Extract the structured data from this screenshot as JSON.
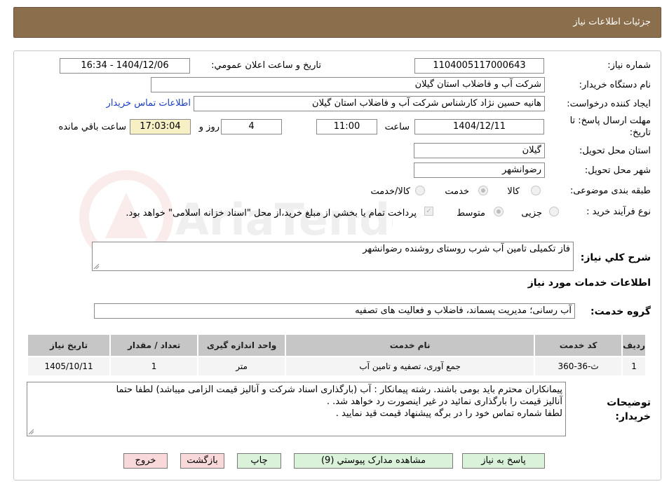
{
  "header": {
    "title": "جزئیات اطلاعات نیاز"
  },
  "form": {
    "need_number_label": "شماره نیاز:",
    "need_number": "1104005117000643",
    "announce_label": "تاریخ و ساعت اعلان عمومي:",
    "announce_value": "1404/12/06 - 16:34",
    "buyer_org_label": "نام دستگاه خريدار:",
    "buyer_org": "شرکت آب و فاضلاب استان گیلان",
    "requester_label": "ايجاد کننده درخواست:",
    "requester": "هانیه حسین نژاد کارشناس شرکت آب و فاضلاب استان گیلان",
    "contact_link": "اطلاعات تماس خريدار",
    "deadline_label": "مهلت ارسال پاسخ: تا تاریخ:",
    "deadline_date": "1404/12/11",
    "time_label": "ساعت",
    "deadline_time": "11:00",
    "days_value": "4",
    "days_label": "روز و",
    "remaining_time": "17:03:04",
    "remaining_label": "ساعت باقي مانده",
    "province_label": "استان محل تحويل:",
    "province": "گیلان",
    "city_label": "شهر محل تحويل:",
    "city": "رضوانشهر",
    "category_label": "طبقه بندی موضوعی:",
    "category_options": [
      "کالا",
      "خدمت",
      "کالا/خدمت"
    ],
    "category_selected": "خدمت",
    "process_label": "نوع فرآيند خريد :",
    "process_options": [
      "جزیی",
      "متوسط"
    ],
    "process_selected": "متوسط",
    "payment_note": "پرداخت تمام يا بخشي از مبلغ خريد،از محل \"اسناد خزانه اسلامی\" خواهد بود."
  },
  "summary": {
    "label": "شرح كلي نياز:",
    "value": "فاز تکمیلی تامین آب شرب روستای روشنده رضوانشهر"
  },
  "services_section": {
    "title": "اطلاعات خدمات مورد نياز",
    "group_label": "گروه خدمت:",
    "group_value": "آب رسانی؛ مدیریت پسماند، فاضلاب و فعالیت های تصفیه"
  },
  "table": {
    "headers": [
      "رديف",
      "کد خدمت",
      "نام خدمت",
      "واحد اندازه گیری",
      "تعداد / مقدار",
      "تاریخ نیاز"
    ],
    "rows": [
      [
        "1",
        "ث-36-360",
        "جمع آوری، تصفیه و تامین آب",
        "متر",
        "1",
        "1405/10/11"
      ]
    ]
  },
  "buyer_notes": {
    "label": "توضيحات خريدار:",
    "lines": [
      "پیمانکاران محترم باید بومی باشند.  رشته پیمانکار :  آب (بارگذاری اسناد شرکت و آنالیز قیمت  الزامی میباشد) لطفا حتما",
      "آنالیز قیمت را بارگذاری نمائید در غیر اینصورت رد خواهد شد. .",
      "لطفا شماره تماس خود را در برگه پیشنهاد قیمت قید نمایید ."
    ]
  },
  "buttons": {
    "reply": "پاسخ به نیاز",
    "attachments": "مشاهده مدارک پیوستي (9)",
    "print": "چاپ",
    "back": "بازگشت",
    "exit": "خروج"
  },
  "watermark": {
    "text": "AriaTender.neT"
  },
  "colors": {
    "header_bg": "#8b6e4b",
    "remaining_bg": "#f7f0c4",
    "link": "#1a3fc1"
  }
}
